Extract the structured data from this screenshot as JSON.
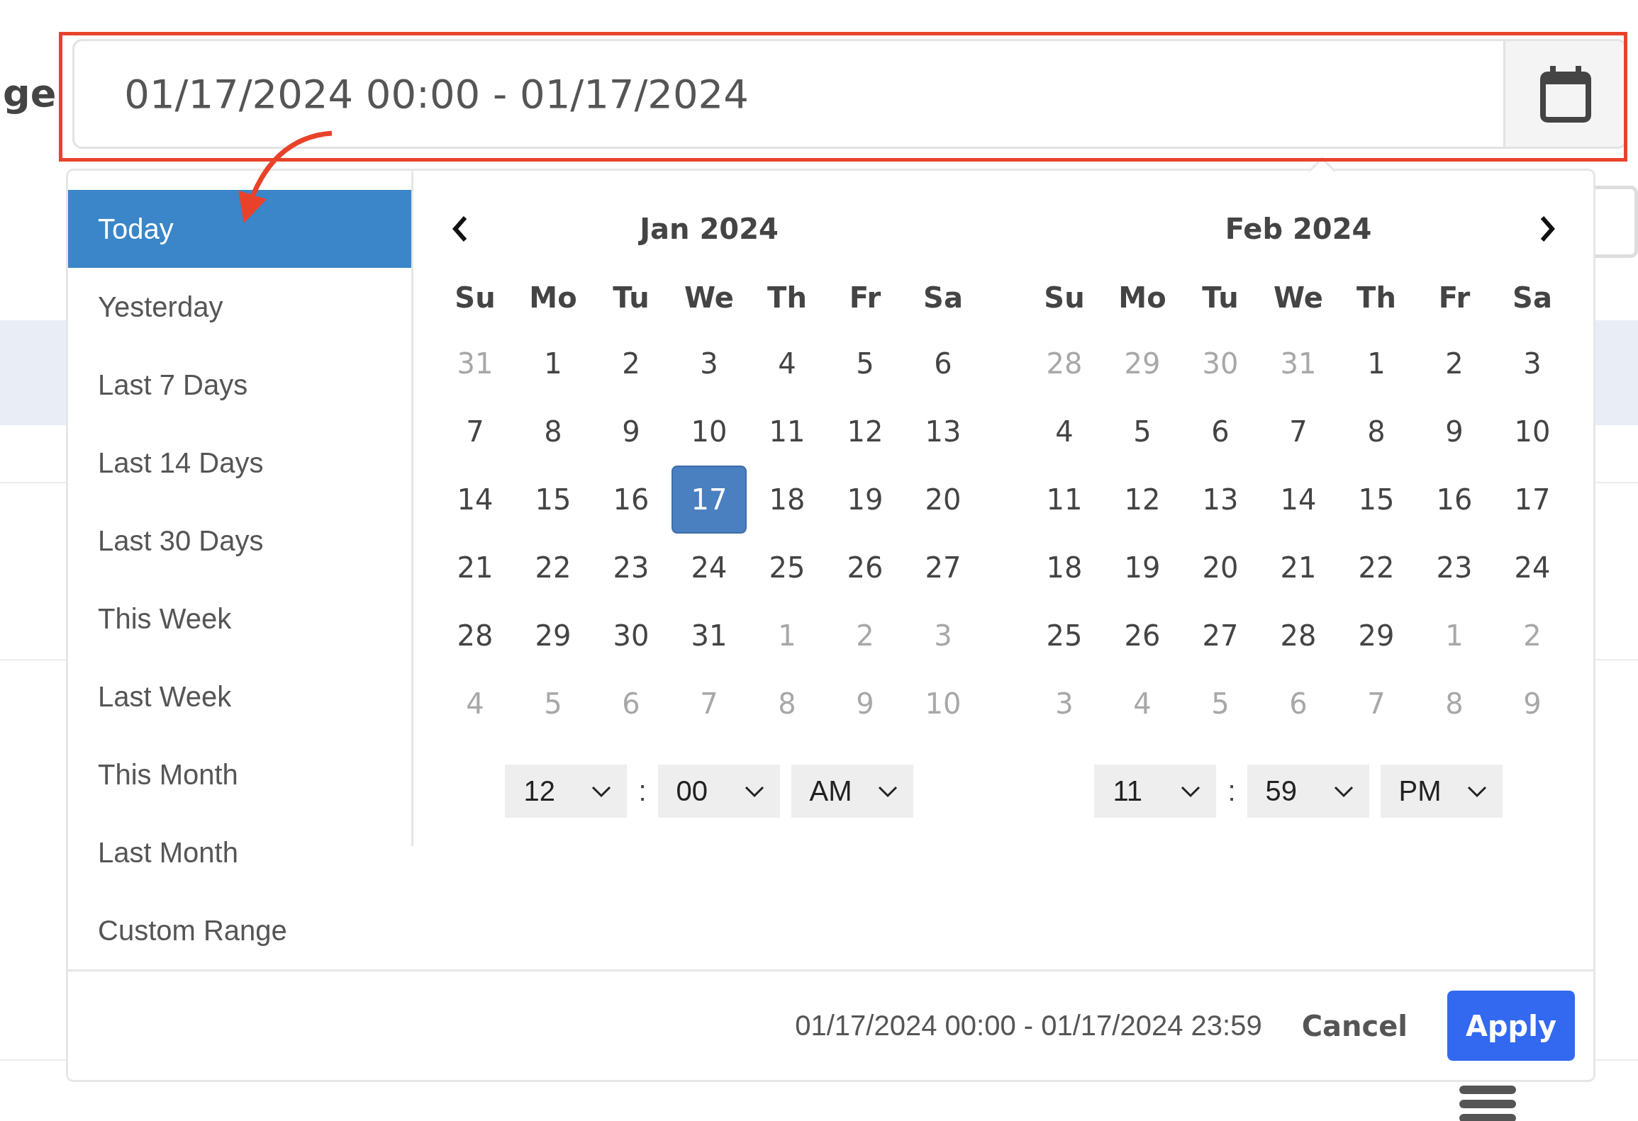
{
  "label": "ge",
  "range_input": {
    "value": "01/17/2024 00:00 - 01/17/2024"
  },
  "ranges": [
    {
      "label": "Today",
      "selected": true
    },
    {
      "label": "Yesterday",
      "selected": false
    },
    {
      "label": "Last 7 Days",
      "selected": false
    },
    {
      "label": "Last 14 Days",
      "selected": false
    },
    {
      "label": "Last 30 Days",
      "selected": false
    },
    {
      "label": "This Week",
      "selected": false
    },
    {
      "label": "Last Week",
      "selected": false
    },
    {
      "label": "This Month",
      "selected": false
    },
    {
      "label": "Last Month",
      "selected": false
    },
    {
      "label": "Custom Range",
      "selected": false
    }
  ],
  "calendars": [
    {
      "title": "Jan 2024",
      "nav_prev": true,
      "nav_next": false,
      "weekdays": [
        "Su",
        "Mo",
        "Tu",
        "We",
        "Th",
        "Fr",
        "Sa"
      ],
      "weeks": [
        [
          {
            "day": "31",
            "muted": true,
            "selected": false
          },
          {
            "day": "1",
            "muted": false,
            "selected": false
          },
          {
            "day": "2",
            "muted": false,
            "selected": false
          },
          {
            "day": "3",
            "muted": false,
            "selected": false
          },
          {
            "day": "4",
            "muted": false,
            "selected": false
          },
          {
            "day": "5",
            "muted": false,
            "selected": false
          },
          {
            "day": "6",
            "muted": false,
            "selected": false
          }
        ],
        [
          {
            "day": "7",
            "muted": false,
            "selected": false
          },
          {
            "day": "8",
            "muted": false,
            "selected": false
          },
          {
            "day": "9",
            "muted": false,
            "selected": false
          },
          {
            "day": "10",
            "muted": false,
            "selected": false
          },
          {
            "day": "11",
            "muted": false,
            "selected": false
          },
          {
            "day": "12",
            "muted": false,
            "selected": false
          },
          {
            "day": "13",
            "muted": false,
            "selected": false
          }
        ],
        [
          {
            "day": "14",
            "muted": false,
            "selected": false
          },
          {
            "day": "15",
            "muted": false,
            "selected": false
          },
          {
            "day": "16",
            "muted": false,
            "selected": false
          },
          {
            "day": "17",
            "muted": false,
            "selected": true
          },
          {
            "day": "18",
            "muted": false,
            "selected": false
          },
          {
            "day": "19",
            "muted": false,
            "selected": false
          },
          {
            "day": "20",
            "muted": false,
            "selected": false
          }
        ],
        [
          {
            "day": "21",
            "muted": false,
            "selected": false
          },
          {
            "day": "22",
            "muted": false,
            "selected": false
          },
          {
            "day": "23",
            "muted": false,
            "selected": false
          },
          {
            "day": "24",
            "muted": false,
            "selected": false
          },
          {
            "day": "25",
            "muted": false,
            "selected": false
          },
          {
            "day": "26",
            "muted": false,
            "selected": false
          },
          {
            "day": "27",
            "muted": false,
            "selected": false
          }
        ],
        [
          {
            "day": "28",
            "muted": false,
            "selected": false
          },
          {
            "day": "29",
            "muted": false,
            "selected": false
          },
          {
            "day": "30",
            "muted": false,
            "selected": false
          },
          {
            "day": "31",
            "muted": false,
            "selected": false
          },
          {
            "day": "1",
            "muted": true,
            "selected": false
          },
          {
            "day": "2",
            "muted": true,
            "selected": false
          },
          {
            "day": "3",
            "muted": true,
            "selected": false
          }
        ],
        [
          {
            "day": "4",
            "muted": true,
            "selected": false
          },
          {
            "day": "5",
            "muted": true,
            "selected": false
          },
          {
            "day": "6",
            "muted": true,
            "selected": false
          },
          {
            "day": "7",
            "muted": true,
            "selected": false
          },
          {
            "day": "8",
            "muted": true,
            "selected": false
          },
          {
            "day": "9",
            "muted": true,
            "selected": false
          },
          {
            "day": "10",
            "muted": true,
            "selected": false
          }
        ]
      ],
      "time": {
        "hour": "12",
        "minute": "00",
        "ampm": "AM",
        "separator": ":"
      }
    },
    {
      "title": "Feb 2024",
      "nav_prev": false,
      "nav_next": true,
      "weekdays": [
        "Su",
        "Mo",
        "Tu",
        "We",
        "Th",
        "Fr",
        "Sa"
      ],
      "weeks": [
        [
          {
            "day": "28",
            "muted": true,
            "selected": false
          },
          {
            "day": "29",
            "muted": true,
            "selected": false
          },
          {
            "day": "30",
            "muted": true,
            "selected": false
          },
          {
            "day": "31",
            "muted": true,
            "selected": false
          },
          {
            "day": "1",
            "muted": false,
            "selected": false
          },
          {
            "day": "2",
            "muted": false,
            "selected": false
          },
          {
            "day": "3",
            "muted": false,
            "selected": false
          }
        ],
        [
          {
            "day": "4",
            "muted": false,
            "selected": false
          },
          {
            "day": "5",
            "muted": false,
            "selected": false
          },
          {
            "day": "6",
            "muted": false,
            "selected": false
          },
          {
            "day": "7",
            "muted": false,
            "selected": false
          },
          {
            "day": "8",
            "muted": false,
            "selected": false
          },
          {
            "day": "9",
            "muted": false,
            "selected": false
          },
          {
            "day": "10",
            "muted": false,
            "selected": false
          }
        ],
        [
          {
            "day": "11",
            "muted": false,
            "selected": false
          },
          {
            "day": "12",
            "muted": false,
            "selected": false
          },
          {
            "day": "13",
            "muted": false,
            "selected": false
          },
          {
            "day": "14",
            "muted": false,
            "selected": false
          },
          {
            "day": "15",
            "muted": false,
            "selected": false
          },
          {
            "day": "16",
            "muted": false,
            "selected": false
          },
          {
            "day": "17",
            "muted": false,
            "selected": false
          }
        ],
        [
          {
            "day": "18",
            "muted": false,
            "selected": false
          },
          {
            "day": "19",
            "muted": false,
            "selected": false
          },
          {
            "day": "20",
            "muted": false,
            "selected": false
          },
          {
            "day": "21",
            "muted": false,
            "selected": false
          },
          {
            "day": "22",
            "muted": false,
            "selected": false
          },
          {
            "day": "23",
            "muted": false,
            "selected": false
          },
          {
            "day": "24",
            "muted": false,
            "selected": false
          }
        ],
        [
          {
            "day": "25",
            "muted": false,
            "selected": false
          },
          {
            "day": "26",
            "muted": false,
            "selected": false
          },
          {
            "day": "27",
            "muted": false,
            "selected": false
          },
          {
            "day": "28",
            "muted": false,
            "selected": false
          },
          {
            "day": "29",
            "muted": false,
            "selected": false
          },
          {
            "day": "1",
            "muted": true,
            "selected": false
          },
          {
            "day": "2",
            "muted": true,
            "selected": false
          }
        ],
        [
          {
            "day": "3",
            "muted": true,
            "selected": false
          },
          {
            "day": "4",
            "muted": true,
            "selected": false
          },
          {
            "day": "5",
            "muted": true,
            "selected": false
          },
          {
            "day": "6",
            "muted": true,
            "selected": false
          },
          {
            "day": "7",
            "muted": true,
            "selected": false
          },
          {
            "day": "8",
            "muted": true,
            "selected": false
          },
          {
            "day": "9",
            "muted": true,
            "selected": false
          }
        ]
      ],
      "time": {
        "hour": "11",
        "minute": "59",
        "ampm": "PM",
        "separator": ":"
      }
    }
  ],
  "footer": {
    "selected_range": "01/17/2024 00:00 - 01/17/2024 23:59",
    "cancel": "Cancel",
    "apply": "Apply"
  }
}
